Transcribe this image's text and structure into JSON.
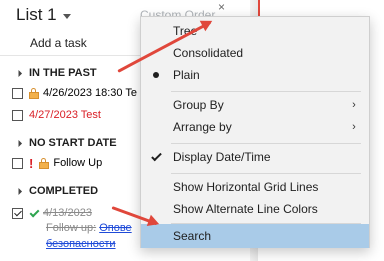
{
  "header": {
    "list_title": "List 1",
    "sort_label": "Custom Order",
    "close_glyph": "×"
  },
  "add_task": {
    "label": "Add a task"
  },
  "groups": {
    "past": "IN THE PAST",
    "no_start": "NO START DATE",
    "completed": "COMPLETED"
  },
  "tasks": {
    "past_1": {
      "text": "4/26/2023 18:30 Te"
    },
    "past_2": {
      "text": "4/27/2023 Test"
    },
    "no_start_1": {
      "priority": "!",
      "text": "Follow Up"
    },
    "completed_1": {
      "date": "4/13/2023",
      "line2_label": "Follow up:",
      "line2_link": "Опове",
      "line3_link": "безопасности"
    }
  },
  "menu": {
    "items": [
      {
        "label": "Tree",
        "icon": "",
        "has_submenu": false
      },
      {
        "label": "Consolidated",
        "icon": "",
        "has_submenu": false
      },
      {
        "label": "Plain",
        "icon": "radio-dot-icon",
        "has_submenu": false
      },
      {
        "label": "Group By",
        "icon": "",
        "has_submenu": true
      },
      {
        "label": "Arrange by",
        "icon": "",
        "has_submenu": true
      },
      {
        "label": "Display Date/Time",
        "icon": "checkmark-icon",
        "has_submenu": false
      },
      {
        "label": "Show Horizontal Grid Lines",
        "icon": "",
        "has_submenu": false
      },
      {
        "label": "Show Alternate Line Colors",
        "icon": "",
        "has_submenu": false
      },
      {
        "label": "Search",
        "icon": "",
        "has_submenu": false,
        "highlighted": true
      }
    ],
    "submenu_glyph": "›"
  },
  "colors": {
    "highlight": "#a9cbe8",
    "menu_bg": "#f2f2f2",
    "arrow": "#e0473b",
    "overdue_red": "#d91f26",
    "link_blue": "#1f4bd8"
  }
}
